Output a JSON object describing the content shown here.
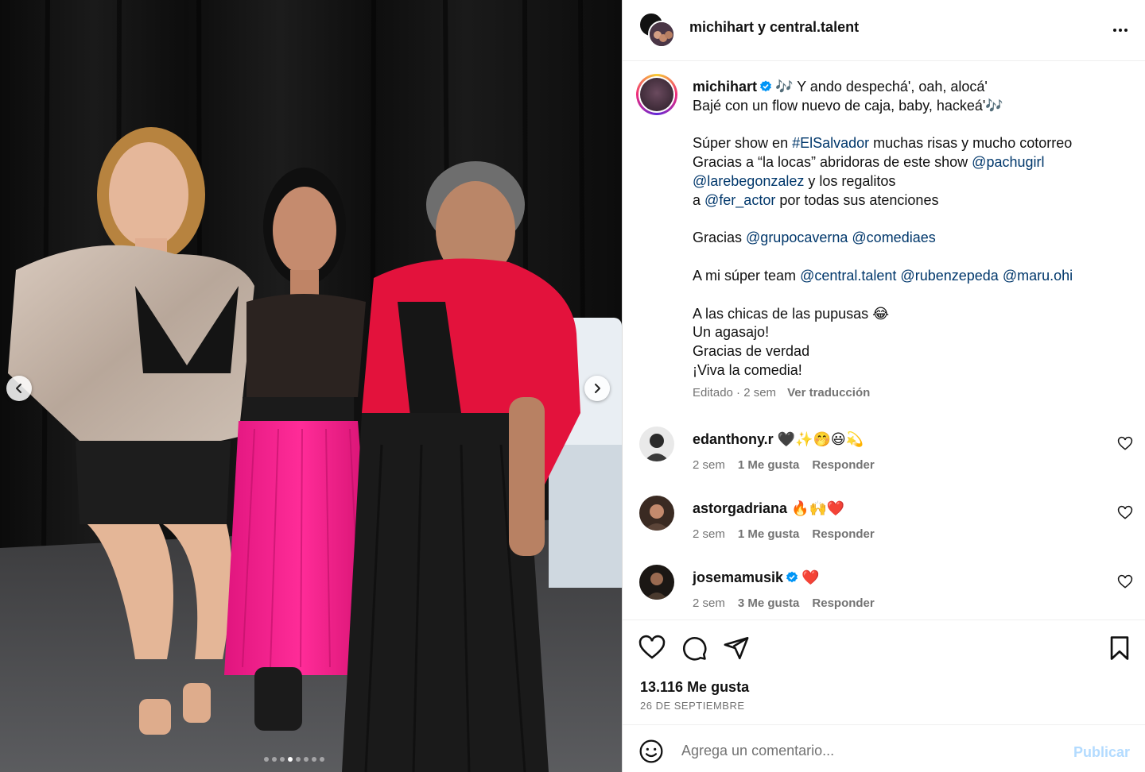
{
  "header": {
    "title": "michihart y central.talent"
  },
  "carousel": {
    "total_slides": 8,
    "active_slide": 4
  },
  "caption": {
    "username": "michihart",
    "line1": "🎶 Y ando despechá', oah, alocá'",
    "line2": "Bajé con un flow nuevo de caja, baby, hackeá'🎶",
    "p2_pre": "Súper show en ",
    "p2_tag": "#ElSalvador",
    "p2_post": " muchas risas y mucho cotorreo",
    "p3_pre": "Gracias a “la locas” abridoras de este show ",
    "p3_m1": "@pachugirl",
    "p3_m2": "@larebegonzalez",
    "p3_mid": " y los regalitos",
    "p3_a": "a ",
    "p3_m3": "@fer_actor",
    "p3_end": " por todas sus atenciones",
    "p4_pre": "Gracias ",
    "p4_m1": "@grupocaverna",
    "p4_m2": "@comediaes",
    "p5_pre": "A mi súper team ",
    "p5_m1": "@central.talent",
    "p5_m2": "@rubenzepeda",
    "p5_m3": "@maru.ohi",
    "p6_l1": "A las chicas de las pupusas 😂",
    "p6_l2": "Un agasajo!",
    "p6_l3": "Gracias de verdad",
    "p6_l4": "¡Viva la comedia!",
    "meta": "Editado · 2 sem",
    "translate": "Ver traducción"
  },
  "comments": [
    {
      "username": "edanthony.r",
      "text": "🖤✨🤭😃💫",
      "verified": false,
      "time": "2 sem",
      "likes": "1 Me gusta",
      "reply": "Responder"
    },
    {
      "username": "astorgadriana",
      "text": "🔥🙌❤️",
      "verified": false,
      "time": "2 sem",
      "likes": "1 Me gusta",
      "reply": "Responder"
    },
    {
      "username": "josemamusik",
      "text": "❤️",
      "verified": true,
      "time": "2 sem",
      "likes": "3 Me gusta",
      "reply": "Responder"
    }
  ],
  "stats": {
    "likes": "13.116 Me gusta",
    "date": "26 DE SEPTIEMBRE"
  },
  "add_comment": {
    "placeholder": "Agrega un comentario...",
    "publish": "Publicar"
  },
  "colors": {
    "link": "#00376b",
    "verified": "#0095f6",
    "muted": "#737373",
    "publish_disabled": "#b3dbff"
  }
}
